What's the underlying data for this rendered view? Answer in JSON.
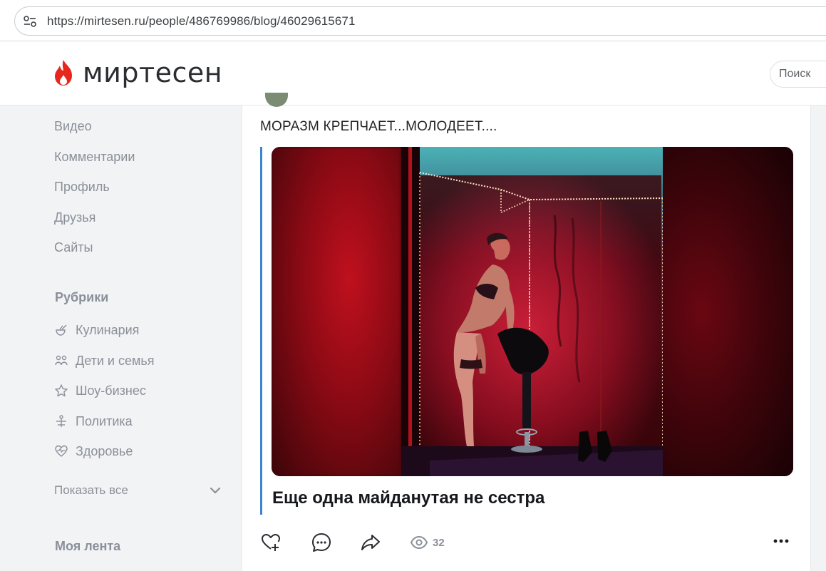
{
  "browser": {
    "url": "https://mirtesen.ru/people/486769986/blog/46029615671",
    "site_info_icon": "tune-icon"
  },
  "header": {
    "logo_text": "миртесен",
    "logo_icon": "flame-icon",
    "brand_color": "#e8271c",
    "search_placeholder": "Поиск"
  },
  "sidebar": {
    "links": [
      {
        "label": "Видео"
      },
      {
        "label": "Комментарии"
      },
      {
        "label": "Профиль"
      },
      {
        "label": "Друзья"
      },
      {
        "label": "Сайты"
      }
    ],
    "rubrics_title": "Рубрики",
    "rubrics": [
      {
        "label": "Кулинария",
        "icon": "cooking-icon"
      },
      {
        "label": "Дети и семья",
        "icon": "family-icon"
      },
      {
        "label": "Шоу-бизнес",
        "icon": "star-icon"
      },
      {
        "label": "Политика",
        "icon": "politics-icon"
      },
      {
        "label": "Здоровье",
        "icon": "heart-pulse-icon"
      }
    ],
    "show_all": "Показать все",
    "feed_title": "Моя лента"
  },
  "post": {
    "text": "МОРАЗМ КРЕПЧАЕТ...МОЛОДЕЕТ....",
    "article_title": "Еще одна майданутая не сестра",
    "quote_color": "#3a86d4",
    "actions": {
      "like_icon": "heart-plus-icon",
      "comment_icon": "comment-icon",
      "share_icon": "share-icon",
      "views_icon": "eye-icon",
      "views_count": "32",
      "more_icon": "more-dots-icon"
    }
  }
}
